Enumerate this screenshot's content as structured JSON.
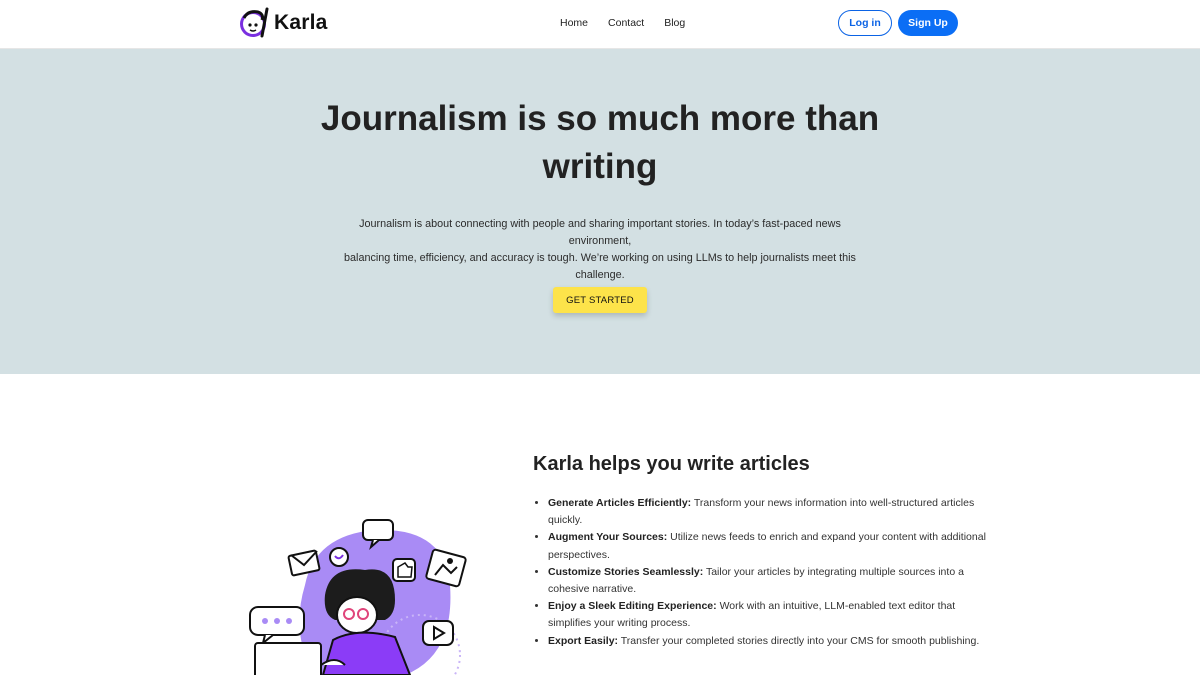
{
  "brand": {
    "name": "Karla",
    "logo_icon": "karla-logo-icon"
  },
  "nav": {
    "links": [
      "Home",
      "Contact",
      "Blog"
    ],
    "login_label": "Log in",
    "signup_label": "Sign Up"
  },
  "hero": {
    "title_line1": "Journalism is so much more than",
    "title_line2": "writing",
    "text_line1": "Journalism is about connecting with people and sharing important stories. In today’s fast-paced news environment,",
    "text_line2": "balancing time, efficiency, and accuracy is tough. We’re working on using LLMs to help journalists meet this challenge.",
    "cta_label": "GET STARTED"
  },
  "features": {
    "title": "Karla helps you write articles",
    "items": [
      {
        "title": "Generate Articles Efficiently:",
        "text": " Transform your news information into well-structured articles quickly."
      },
      {
        "title": "Augment Your Sources:",
        "text": " Utilize news feeds to enrich and expand your content with additional perspectives."
      },
      {
        "title": "Customize Stories Seamlessly:",
        "text": " Tailor your articles by integrating multiple sources into a cohesive narrative."
      },
      {
        "title": "Enjoy a Sleek Editing Experience:",
        "text": " Work with an intuitive, LLM-enabled text editor that simplifies your writing process."
      },
      {
        "title": "Export Easily:",
        "text": " Transfer your completed stories directly into your CMS for smooth publishing."
      }
    ]
  },
  "colors": {
    "hero_bg": "#d3e0e3",
    "primary": "#0b6ef5",
    "cta": "#fde34a",
    "accent_purple": "#8b3cf7"
  }
}
